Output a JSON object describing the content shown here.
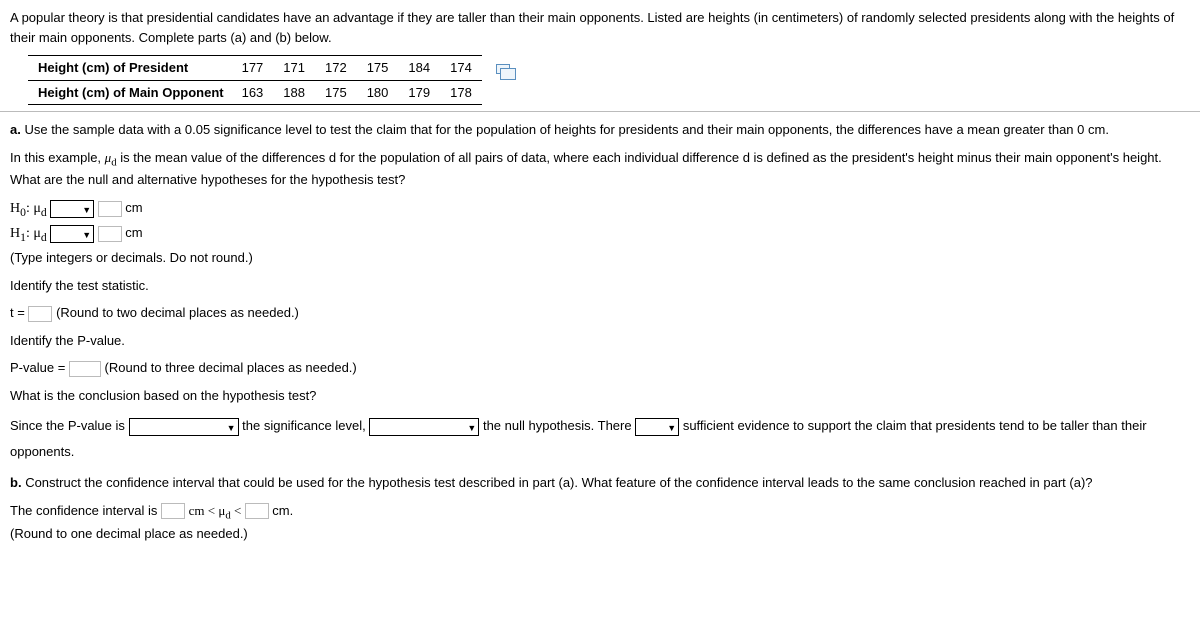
{
  "intro": "A popular theory is that presidential candidates have an advantage if they are taller than their main opponents. Listed are heights (in centimeters) of randomly selected presidents along with the heights of their main opponents. Complete parts (a) and (b) below.",
  "table": {
    "row1_label": "Height (cm) of President",
    "row2_label": "Height (cm) of Main Opponent",
    "row1": [
      "177",
      "171",
      "172",
      "175",
      "184",
      "174"
    ],
    "row2": [
      "163",
      "188",
      "175",
      "180",
      "179",
      "178"
    ]
  },
  "partA": {
    "label": "a.",
    "prompt": "Use the sample data with a 0.05 significance level to test the claim that for the population of heights for presidents and their main opponents, the differences have a mean greater than 0 cm.",
    "explain1": "In this example, ",
    "explain_mu": "μ",
    "explain_sub": "d",
    "explain2": " is the mean value of the differences d for the population of all pairs of data, where each individual difference d is defined as the president's height minus their main opponent's height. What are the null and alternative hypotheses for the hypothesis test?",
    "h0_label": "H",
    "h0_sub": "0",
    "h0_colon": ": μ",
    "h0_sub2": "d",
    "h1_label": "H",
    "h1_sub": "1",
    "h1_colon": ": μ",
    "h1_sub2": "d",
    "cm": "cm",
    "hyp_hint": "(Type integers or decimals. Do not round.)",
    "iden_stat": "Identify the test statistic.",
    "t_eq": "t =",
    "t_hint": "(Round to two decimal places as needed.)",
    "iden_p": "Identify the P-value.",
    "p_eq": "P-value =",
    "p_hint": "(Round to three decimal places as needed.)",
    "concl_q": "What is the conclusion based on the hypothesis test?",
    "concl_1": "Since the P-value is ",
    "concl_2": " the significance level, ",
    "concl_3": " the null hypothesis. There ",
    "concl_4": " sufficient evidence to support the claim that presidents tend to be taller than their opponents."
  },
  "partB": {
    "label": "b.",
    "prompt": "Construct the confidence interval that could be used for the hypothesis test described in part (a). What feature of the confidence interval leads to the same conclusion reached in part (a)?",
    "ci_1": "The confidence interval is ",
    "ci_mid1": " cm < μ",
    "ci_sub": "d",
    "ci_mid2": " < ",
    "ci_end": " cm.",
    "ci_hint": "(Round to one decimal place as needed.)"
  }
}
